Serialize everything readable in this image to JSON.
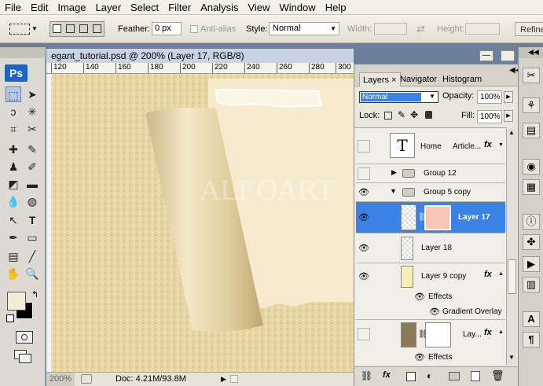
{
  "menu": [
    "File",
    "Edit",
    "Image",
    "Layer",
    "Select",
    "Filter",
    "Analysis",
    "View",
    "Window",
    "Help"
  ],
  "options": {
    "feather_label": "Feather:",
    "feather_value": "0 px",
    "antialias_label": "Anti-alias",
    "style_label": "Style:",
    "style_value": "Normal",
    "width_label": "Width:",
    "height_label": "Height:",
    "refine_label": "Refine"
  },
  "toolbox": {
    "logo": "Ps"
  },
  "document": {
    "title": "egant_tutorial.psd @ 200% (Layer 17, RGB/8)",
    "ruler_ticks": [
      "120",
      "140",
      "160",
      "180",
      "200",
      "220",
      "240",
      "260",
      "280",
      "300"
    ],
    "watermark": "ALFOART",
    "zoom": "200%",
    "doc_info": "Doc: 4.21M/93.8M"
  },
  "panel": {
    "tabs": [
      "Layers",
      "Navigator",
      "Histogram"
    ],
    "blend_mode": "Normal",
    "opacity_label": "Opacity:",
    "opacity_value": "100%",
    "lock_label": "Lock:",
    "fill_label": "Fill:",
    "fill_value": "100%",
    "layers": {
      "home_name": "Home",
      "home_text": "Article...",
      "home_thumb": "T",
      "group12": "Group 12",
      "group5": "Group 5 copy",
      "layer17": "Layer 17",
      "layer18": "Layer 18",
      "layer9": "Layer 9 copy",
      "effects": "Effects",
      "gradient_overlay": "Gradient Overlay",
      "lay": "Lay...",
      "effects2": "Effects"
    },
    "fx": "fx"
  },
  "colors": {
    "selection": "#3a82e6",
    "foreground": "#f3ecda",
    "background": "#000000"
  }
}
